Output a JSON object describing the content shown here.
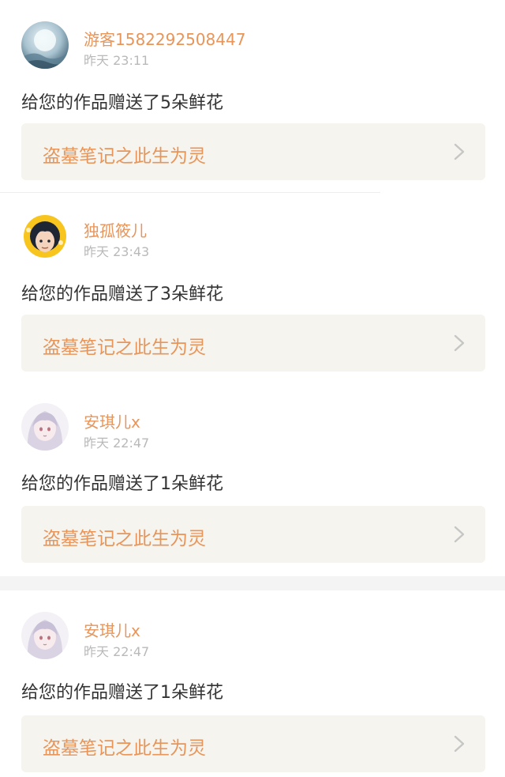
{
  "notifications": [
    {
      "user": "游客1582292508447",
      "time": "昨天 23:11",
      "message": "给您的作品赠送了5朵鲜花",
      "work_title": "盗墓笔记之此生为灵",
      "avatar_icon": "moon-landscape-avatar"
    },
    {
      "user": "独孤筱儿",
      "time": "昨天 23:43",
      "message": "给您的作品赠送了3朵鲜花",
      "work_title": "盗墓笔记之此生为灵",
      "avatar_icon": "cartoon-boy-avatar"
    },
    {
      "user": "安琪儿x",
      "time": "昨天 22:47",
      "message": "给您的作品赠送了1朵鲜花",
      "work_title": "盗墓笔记之此生为灵",
      "avatar_icon": "anime-girl-avatar"
    },
    {
      "user": "安琪儿x",
      "time": "昨天 22:47",
      "message": "给您的作品赠送了1朵鲜花",
      "work_title": "盗墓笔记之此生为灵",
      "avatar_icon": "anime-girl-avatar"
    }
  ],
  "icons": {
    "chevron": "chevron-right-icon"
  },
  "colors": {
    "accent": "#e8955a",
    "time": "#b9b9b9",
    "message": "#333333",
    "link_bg": "#f5f4ee"
  }
}
